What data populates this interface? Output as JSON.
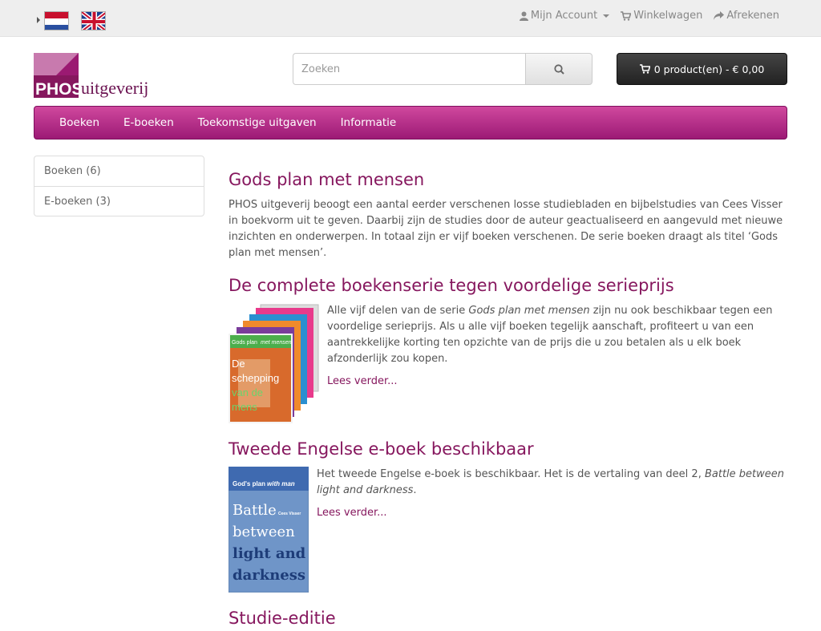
{
  "topbar": {
    "languages": [
      {
        "name": "Nederlands",
        "icon": "flag-nl-icon"
      },
      {
        "name": "English",
        "icon": "flag-en-icon"
      }
    ],
    "links": {
      "account": "Mijn Account",
      "cart": "Winkelwagen",
      "checkout": "Afrekenen"
    }
  },
  "header": {
    "logo": {
      "brand": "PHOS",
      "sub": "uitgeverij"
    },
    "search": {
      "placeholder": "Zoeken"
    },
    "cart_button": "0 product(en) - € 0,00"
  },
  "menu": [
    "Boeken",
    "E-boeken",
    "Toekomstige uitgaven",
    "Informatie"
  ],
  "sidebar": [
    "Boeken (6)",
    "E-boeken (3)"
  ],
  "main": {
    "intro_title": "Gods plan met mensen",
    "intro_text": "PHOS uitgeverij beoogt een aantal eerder verschenen losse studiebladen en bijbelstudies van Cees Visser in boekvorm uit te geven. Daarbij zijn de studies door de auteur geactualiseerd en aangevuld met nieuwe inzichten en onderwerpen. In totaal zijn er vijf boeken verschenen. De serie boeken draagt als titel ‘Gods plan met mensen’.",
    "articles": [
      {
        "title": "De complete boekenserie tegen voordelige serieprijs",
        "text_before": "Alle vijf delen van de serie ",
        "text_em": "Gods plan met mensen",
        "text_after": " zijn nu ook beschikbaar tegen een voordelige serieprijs. Als u alle vijf boeken tegelijk aanschaft, profiteert u van een aantrekkelijke korting ten opzichte van de prijs die u zou betalen als u elk boek afzonderlijk zou kopen.",
        "read_more": "Lees verder...",
        "cover": {
          "series": "Gods plan",
          "series_em": "met mensen",
          "words": [
            "De",
            "schepping",
            "van de",
            "mens"
          ]
        }
      },
      {
        "title": "Tweede Engelse e-boek beschikbaar",
        "text_before": "Het tweede Engelse e-boek is beschikbaar. Het is de vertaling van deel 2, ",
        "text_em": "Battle between light and darkness",
        "text_after": ".",
        "read_more": "Lees verder...",
        "cover": {
          "series": "God's plan",
          "series_em": "with man",
          "author": "Cees Visser",
          "words": [
            "Battle",
            "between",
            "light and",
            "darkness"
          ]
        }
      },
      {
        "title": "Studie-editie"
      }
    ]
  }
}
